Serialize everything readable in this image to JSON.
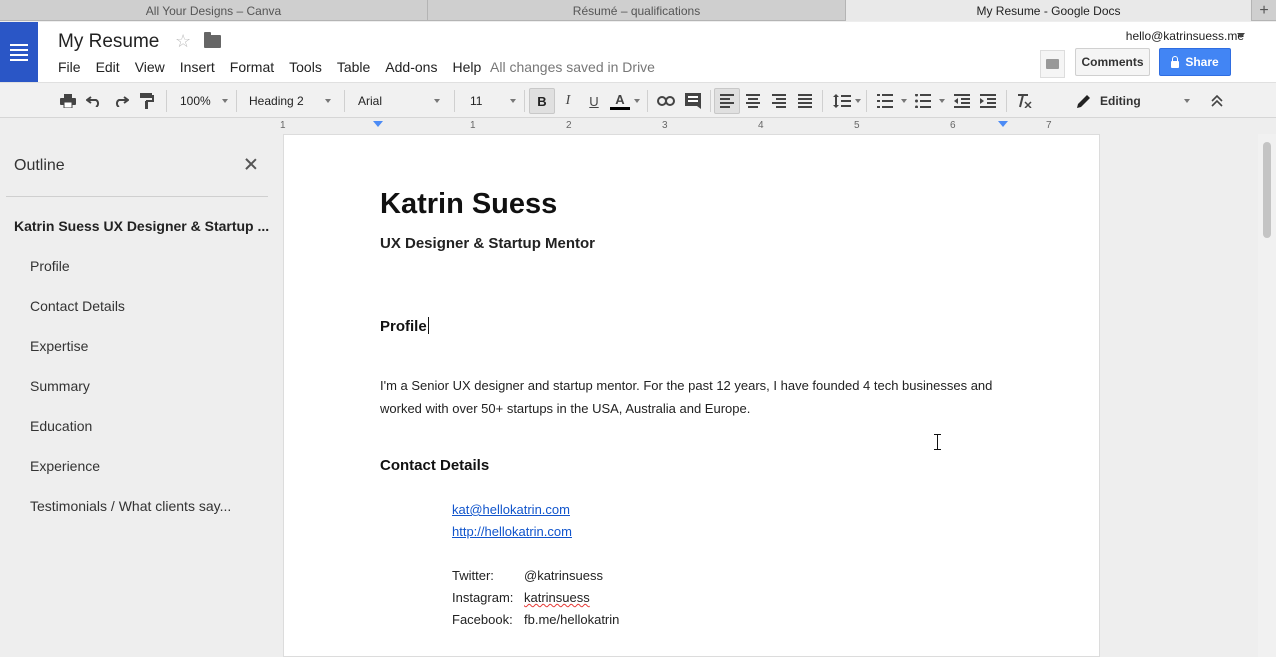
{
  "browser": {
    "tabs": [
      {
        "label": "All Your Designs – Canva"
      },
      {
        "label": "Résumé – qualifications"
      },
      {
        "label": "My Resume - Google Docs"
      }
    ],
    "new_tab": "+"
  },
  "header": {
    "doc_title": "My Resume",
    "saved_status": "All changes saved in Drive",
    "account": "hello@katrinsuess.me",
    "comments_label": "Comments",
    "share_label": "Share",
    "accent_color": "#4285f4"
  },
  "menu": [
    "File",
    "Edit",
    "View",
    "Insert",
    "Format",
    "Tools",
    "Table",
    "Add-ons",
    "Help"
  ],
  "toolbar": {
    "zoom": "100%",
    "style": "Heading 2",
    "font": "Arial",
    "font_size": "11",
    "bold": "B",
    "italic": "I",
    "underline": "U",
    "text_color": "A",
    "mode": "Editing",
    "icons": [
      "print-icon",
      "undo-icon",
      "redo-icon",
      "paint-format-icon",
      "link-icon",
      "comment-icon",
      "align-left-icon",
      "align-center-icon",
      "align-right-icon",
      "justify-icon",
      "line-spacing-icon",
      "numbered-list-icon",
      "bulleted-list-icon",
      "decrease-indent-icon",
      "increase-indent-icon",
      "clear-formatting-icon",
      "pencil-icon",
      "collapse-icon"
    ]
  },
  "ruler": {
    "numbers": [
      "1",
      "1",
      "2",
      "3",
      "4",
      "5",
      "6",
      "7"
    ]
  },
  "outline": {
    "title": "Outline",
    "heading": "Katrin Suess UX Designer & Startup ...",
    "items": [
      "Profile",
      "Contact Details",
      "Expertise",
      "Summary",
      "Education",
      "Experience",
      "Testimonials / What clients say..."
    ]
  },
  "document": {
    "name": "Katrin Suess",
    "subtitle": "UX Designer & Startup Mentor",
    "profile_heading": "Profile",
    "profile_text": "I'm a Senior UX designer and startup mentor. For the past 12 years, I have founded 4 tech businesses and worked with over 50+ startups in the USA, Australia and Europe.",
    "contact_heading": "Contact Details",
    "email": "kat@hellokatrin.com",
    "website": "http://hellokatrin.com",
    "socials": [
      {
        "label": "Twitter:",
        "value": "@katrinsuess"
      },
      {
        "label": "Instagram:",
        "value": "katrinsuess"
      },
      {
        "label": "Facebook:",
        "value": "fb.me/hellokatrin"
      }
    ]
  }
}
